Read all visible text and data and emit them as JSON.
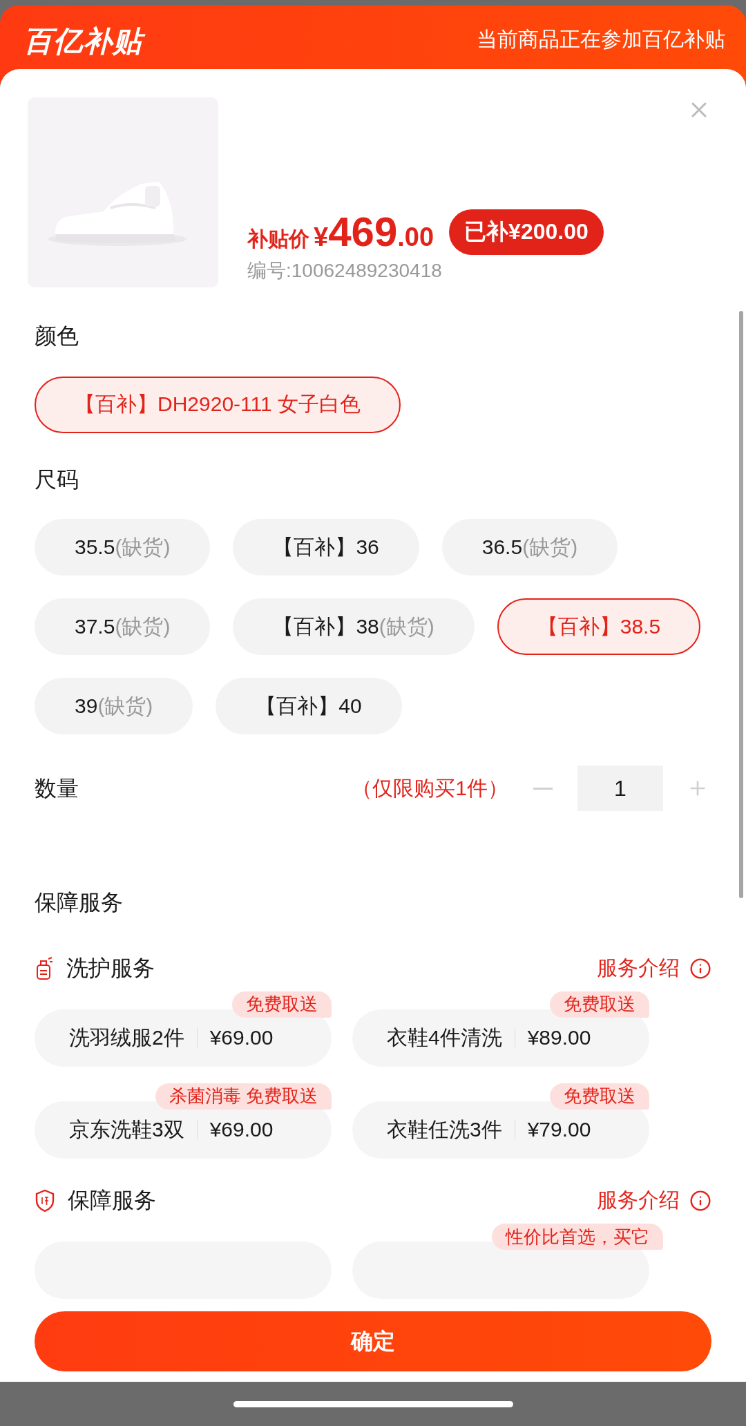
{
  "header": {
    "logo": "百亿补贴",
    "notice": "当前商品正在参加百亿补贴"
  },
  "product": {
    "price": {
      "label": "补贴价",
      "currency": "¥",
      "integer": "469",
      "decimal": ".00"
    },
    "subsidy_badge": "已补¥200.00",
    "sku": "编号:10062489230418"
  },
  "color": {
    "title": "颜色",
    "options": [
      {
        "label": "【百补】DH2920-111 女子白色",
        "selected": true
      }
    ]
  },
  "size": {
    "title": "尺码",
    "options": [
      {
        "label": "35.5",
        "note": "(缺货)",
        "selected": false
      },
      {
        "label": "【百补】36",
        "selected": false
      },
      {
        "label": "36.5",
        "note": "(缺货)",
        "selected": false
      },
      {
        "label": "37.5",
        "note": "(缺货)",
        "selected": false
      },
      {
        "label": "【百补】38",
        "note": "(缺货)",
        "selected": false
      },
      {
        "label": "【百补】38.5",
        "selected": true
      },
      {
        "label": "39",
        "note": "(缺货)",
        "selected": false
      },
      {
        "label": "【百补】40",
        "selected": false
      }
    ]
  },
  "quantity": {
    "title": "数量",
    "limit_note": "（仅限购买1件）",
    "value": "1",
    "decrease": {
      "disabled": true
    },
    "increase": {
      "disabled": true
    }
  },
  "services": {
    "title": "保障服务",
    "groups": [
      {
        "kind": "wash",
        "title": "洗护服务",
        "link": "服务介绍",
        "items": [
          {
            "kind": "card",
            "name": "洗羽绒服2件",
            "price": "¥69.00",
            "tag": "免费取送"
          },
          {
            "kind": "card",
            "name": "衣鞋4件清洗",
            "price": "¥89.00",
            "tag": "免费取送"
          },
          {
            "kind": "card",
            "name": "京东洗鞋3双",
            "price": "¥69.00",
            "tag": "杀菌消毒 免费取送"
          },
          {
            "kind": "card",
            "name": "衣鞋任洗3件",
            "price": "¥79.00",
            "tag": "免费取送"
          }
        ]
      },
      {
        "kind": "guarantee",
        "title": "保障服务",
        "link": "服务介绍",
        "items": [
          {
            "kind": "partial"
          },
          {
            "kind": "partial",
            "tag": "性价比首选，买它"
          }
        ]
      }
    ]
  },
  "confirm_button": "确定"
}
